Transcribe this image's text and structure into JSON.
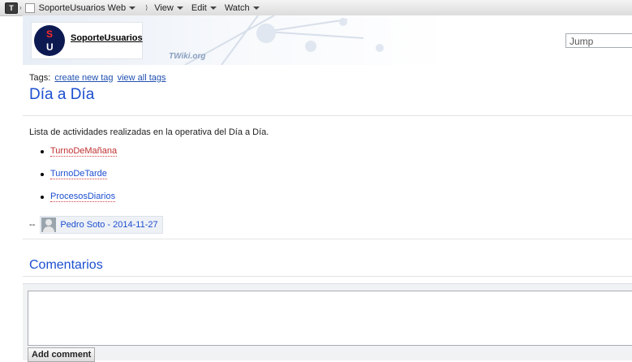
{
  "toolbar": {
    "logo_glyph": "T",
    "web_label": "SoporteUsuarios Web",
    "menus": [
      "View",
      "Edit",
      "Watch"
    ]
  },
  "header": {
    "logo_letters": [
      "S",
      "U"
    ],
    "logo_text": "SoporteUsuarios",
    "watermark": "TWiki.org",
    "jump_placeholder": "Jump"
  },
  "tags": {
    "label": "Tags:",
    "create": "create new tag",
    "view_all": "view all tags"
  },
  "page": {
    "title": "Día a Día",
    "description": "Lista de actividades realizadas en la operativa del Día a Día.",
    "items": [
      "TurnoDeMañana",
      "TurnoDeTarde",
      "ProcesosDiarios"
    ]
  },
  "signature": {
    "prefix": "--",
    "text": "Pedro Soto - 2014-11-27"
  },
  "comments": {
    "title": "Comentarios",
    "button": "Add comment"
  },
  "colors": {
    "link": "#1c4fcf",
    "missing_link": "#c03030",
    "logo_bg": "#0d1a52",
    "logo_s": "#ff2a2a"
  }
}
